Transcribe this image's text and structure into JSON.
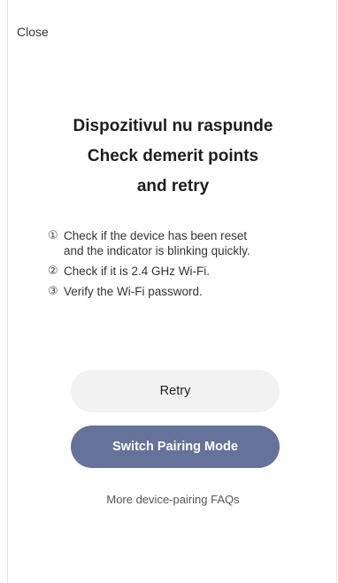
{
  "header": {
    "close_label": "Close"
  },
  "title": {
    "line1": "Dispozitivul nu raspunde",
    "line2": "Check demerit points",
    "line3": "and retry"
  },
  "steps": [
    {
      "number": "①",
      "text_line1": "Check if the device has been reset",
      "text_line2": "and the indicator is blinking quickly."
    },
    {
      "number": "②",
      "text_line1": "Check if it is 2.4 GHz Wi-Fi.",
      "text_line2": ""
    },
    {
      "number": "③",
      "text_line1": "Verify the Wi-Fi password.",
      "text_line2": ""
    }
  ],
  "actions": {
    "retry_label": "Retry",
    "switch_label": "Switch Pairing Mode"
  },
  "footer": {
    "faq_label": "More device-pairing FAQs"
  },
  "colors": {
    "primary_button": "#65729a",
    "secondary_button": "#f2f2f2"
  }
}
